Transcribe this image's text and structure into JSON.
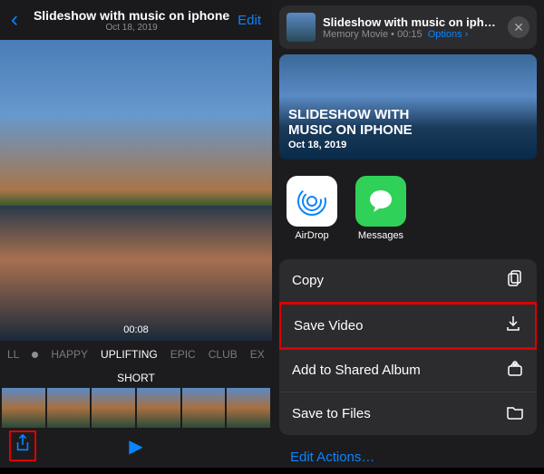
{
  "left": {
    "header": {
      "title": "Slideshow with music on iphone",
      "subtitle": "Oct 18, 2019",
      "edit": "Edit"
    },
    "timecode": "00:08",
    "moods": [
      "LL",
      "HAPPY",
      "UPLIFTING",
      "EPIC",
      "CLUB",
      "EX"
    ],
    "selected_mood": 2,
    "duration_label": "SHORT"
  },
  "right": {
    "card": {
      "title": "Slideshow with music on iphone",
      "subtitle_prefix": "Memory Movie",
      "duration": "00:15",
      "options": "Options"
    },
    "preview": {
      "line1": "SLIDESHOW WITH",
      "line2": "MUSIC ON IPHONE",
      "date": "Oct 18, 2019"
    },
    "apps": [
      {
        "name": "AirDrop"
      },
      {
        "name": "Messages"
      }
    ],
    "actions": [
      {
        "label": "Copy",
        "icon": "copy"
      },
      {
        "label": "Save Video",
        "icon": "download",
        "highlight": true
      },
      {
        "label": "Add to Shared Album",
        "icon": "shared-album"
      },
      {
        "label": "Save to Files",
        "icon": "folder"
      }
    ],
    "edit_actions": "Edit Actions…"
  }
}
